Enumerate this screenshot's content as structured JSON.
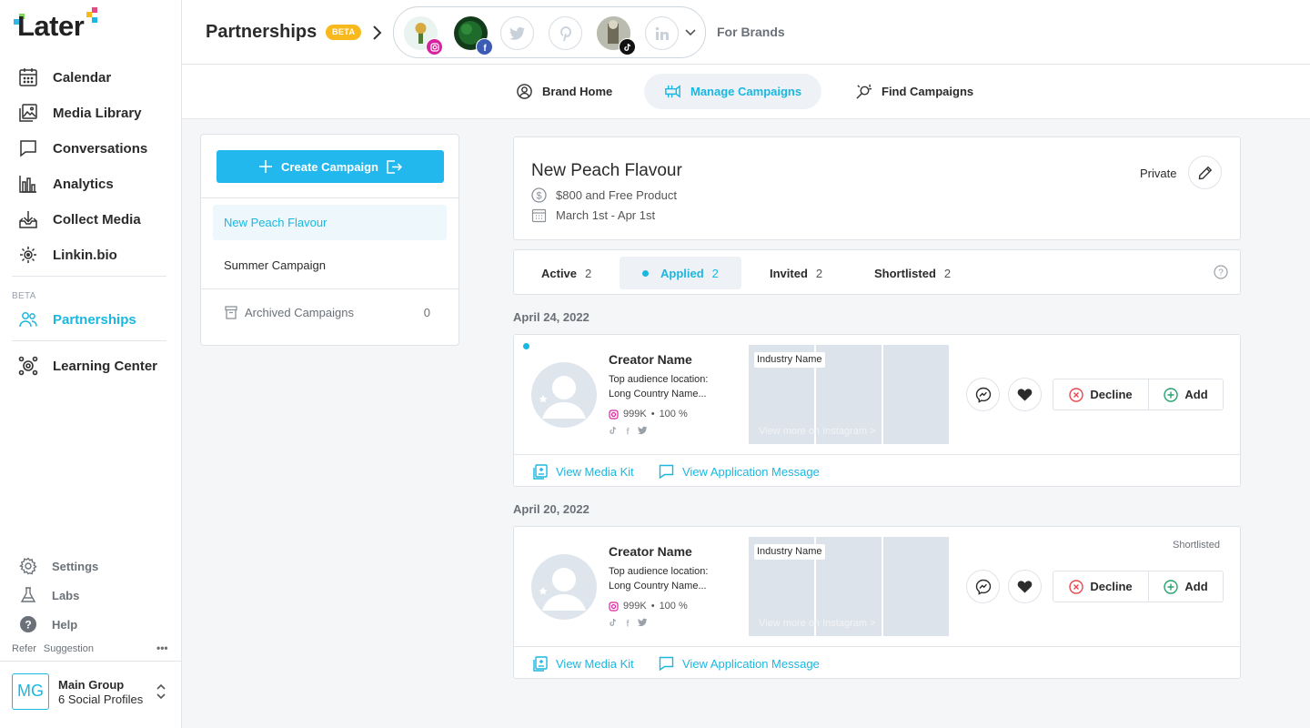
{
  "app": {
    "logo_text": "Later"
  },
  "sidebar": {
    "items": [
      {
        "label": "Calendar",
        "icon": "calendar-icon"
      },
      {
        "label": "Media Library",
        "icon": "media-library-icon"
      },
      {
        "label": "Conversations",
        "icon": "chat-icon"
      },
      {
        "label": "Analytics",
        "icon": "bar-chart-icon"
      },
      {
        "label": "Collect Media",
        "icon": "download-icon"
      },
      {
        "label": "Linkin.bio",
        "icon": "linkinbio-icon"
      }
    ],
    "beta_label": "BETA",
    "partnerships": {
      "label": "Partnerships",
      "icon": "people-icon"
    },
    "learning": {
      "label": "Learning Center",
      "icon": "learning-icon"
    },
    "bottom": [
      {
        "label": "Settings",
        "icon": "gear-icon"
      },
      {
        "label": "Labs",
        "icon": "flask-icon"
      },
      {
        "label": "Help",
        "icon": "help-icon"
      }
    ],
    "refer": "Refer",
    "suggestion": "Suggestion",
    "more": "•••",
    "group": {
      "initials": "MG",
      "name": "Main Group",
      "profiles": "6 Social Profiles"
    }
  },
  "header": {
    "title": "Partnerships",
    "badge": "BETA",
    "for_brands": "For Brands",
    "profiles": [
      "instagram",
      "facebook",
      "twitter",
      "pinterest",
      "tiktok",
      "linkedin"
    ]
  },
  "tabs": [
    {
      "label": "Brand Home",
      "icon": "brand-home-icon"
    },
    {
      "label": "Manage Campaigns",
      "icon": "manage-campaigns-icon",
      "active": true
    },
    {
      "label": "Find Campaigns",
      "icon": "find-campaigns-icon"
    }
  ],
  "campaigns": {
    "create_label": "Create Campaign",
    "items": [
      "New Peach Flavour",
      "Summer Campaign"
    ],
    "archived_label": "Archived Campaigns",
    "archived_count": "0"
  },
  "detail": {
    "title": "New Peach Flavour",
    "compensation": "$800 and Free Product",
    "dates": "March 1st - Apr 1st",
    "visibility": "Private"
  },
  "filters": [
    {
      "label": "Active",
      "count": "2"
    },
    {
      "label": "Applied",
      "count": "2",
      "active": true
    },
    {
      "label": "Invited",
      "count": "2"
    },
    {
      "label": "Shortlisted",
      "count": "2"
    }
  ],
  "applications": [
    {
      "date": "April 24, 2022",
      "is_new": true,
      "creator": "Creator Name",
      "location_label": "Top audience location:",
      "location": "Long Country Name...",
      "followers": "999K",
      "engagement": "100 %",
      "industry": "Industry Name",
      "view_more": "View more on Instagram >",
      "status": "",
      "decline": "Decline",
      "add": "Add",
      "media_kit": "View Media Kit",
      "message": "View Application Message"
    },
    {
      "date": "April 20, 2022",
      "is_new": false,
      "creator": "Creator Name",
      "location_label": "Top audience location:",
      "location": "Long Country Name...",
      "followers": "999K",
      "engagement": "100 %",
      "industry": "Industry Name",
      "view_more": "View more on Instagram >",
      "status": "Shortlisted",
      "decline": "Decline",
      "add": "Add",
      "media_kit": "View Media Kit",
      "message": "View Application Message"
    }
  ],
  "colors": {
    "accent": "#1ab7e0",
    "badge": "#f7b91c",
    "decline": "#e5484d",
    "add": "#27a26f",
    "instagram": "#d6249f"
  }
}
